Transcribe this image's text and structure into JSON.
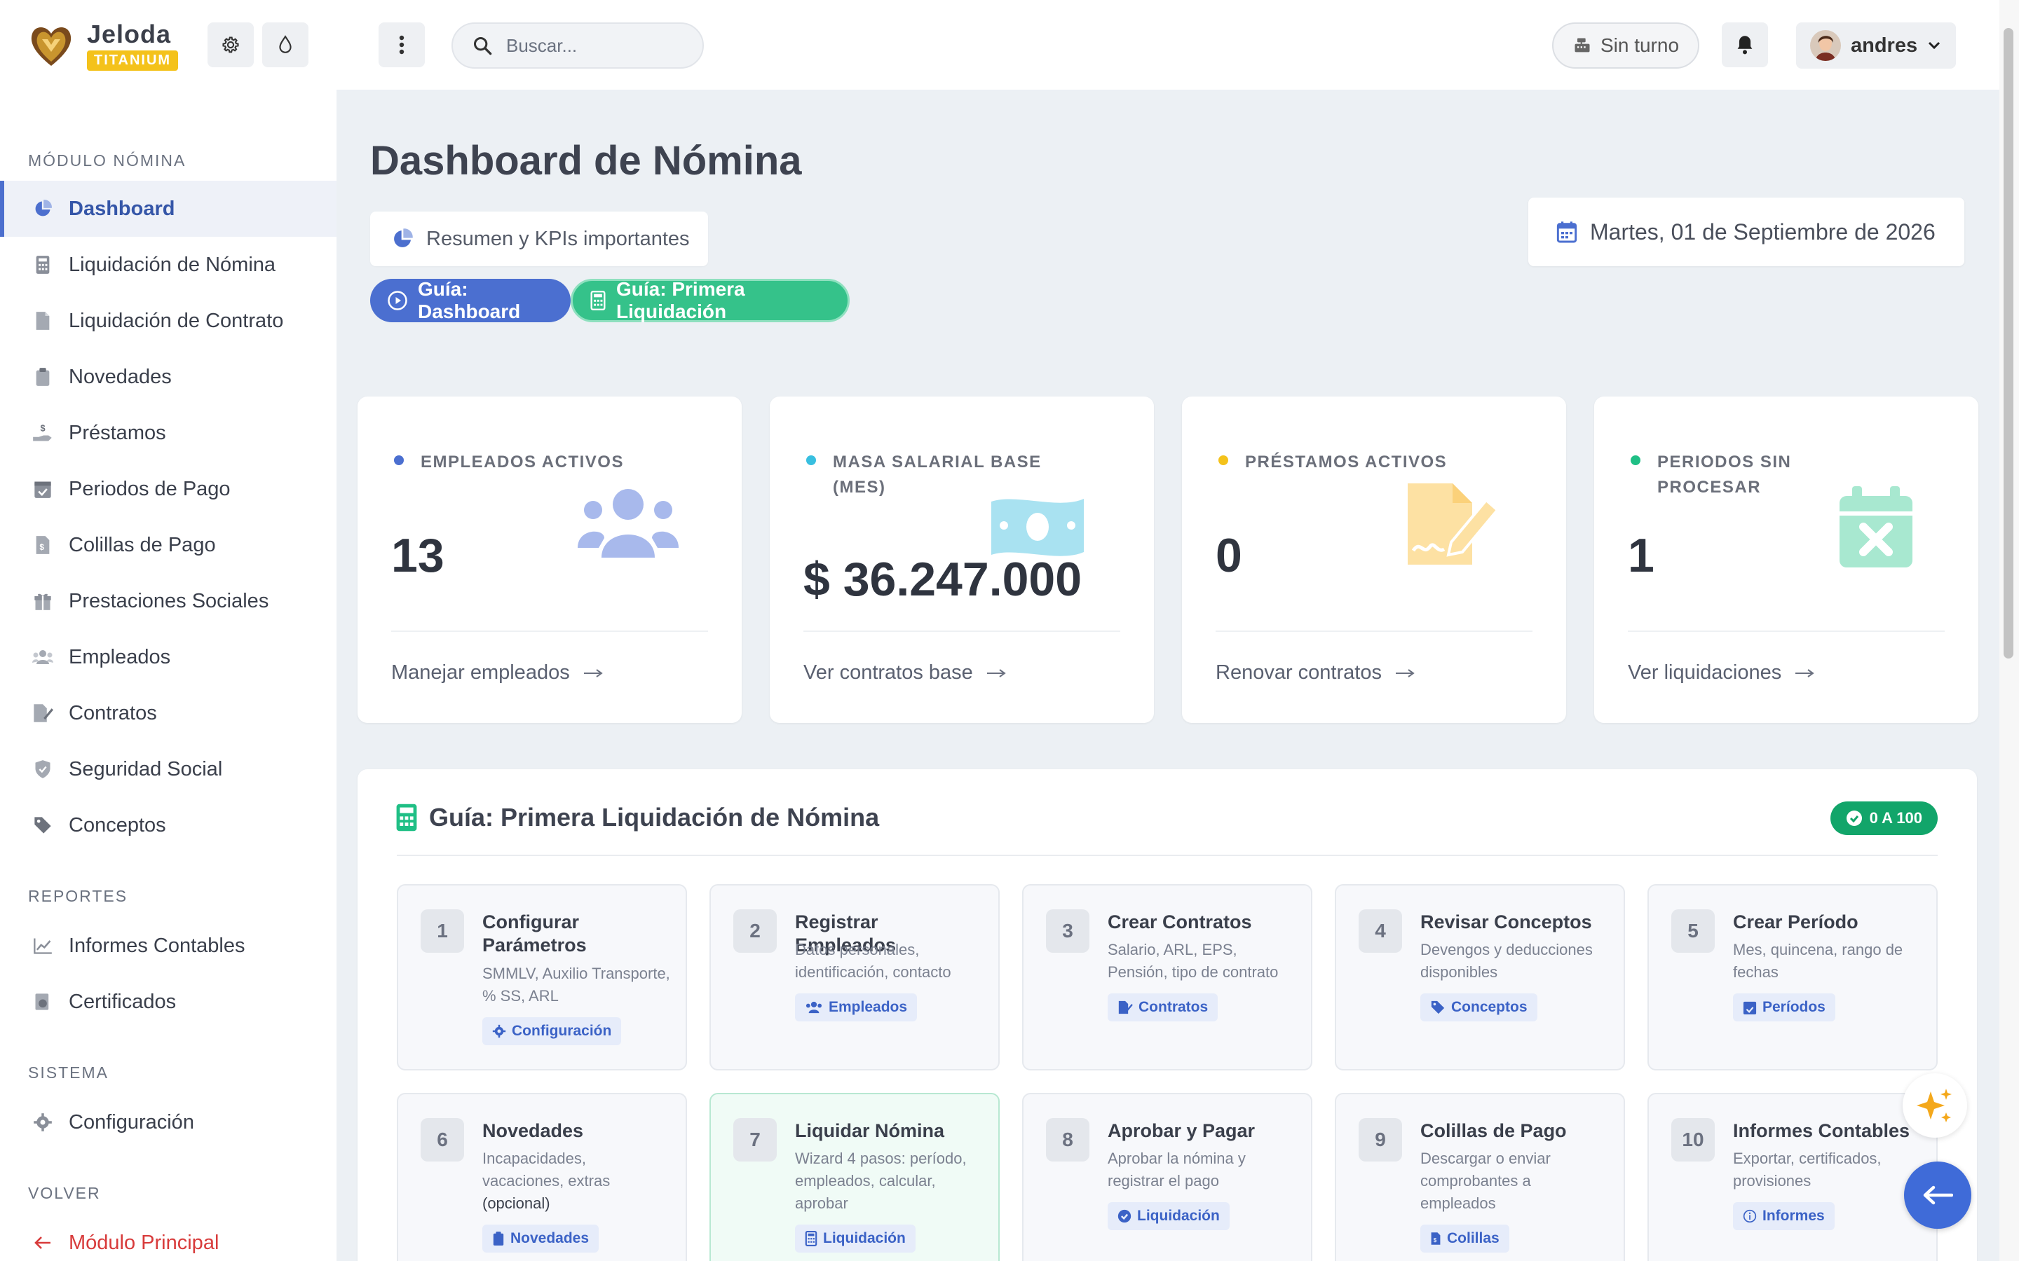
{
  "brand": {
    "name": "Jeloda",
    "edition": "TITANIUM"
  },
  "topbar": {
    "search_placeholder": "Buscar...",
    "shift_label": "Sin turno",
    "user_name": "andres"
  },
  "sidebar": {
    "sections": [
      {
        "title": "MÓDULO NÓMINA"
      },
      {
        "title": "REPORTES"
      },
      {
        "title": "SISTEMA"
      },
      {
        "title": "VOLVER"
      }
    ],
    "items": [
      {
        "label": "Dashboard",
        "icon": "pie-chart-icon",
        "active": true
      },
      {
        "label": "Liquidación de Nómina",
        "icon": "calculator-icon"
      },
      {
        "label": "Liquidación de Contrato",
        "icon": "file-icon"
      },
      {
        "label": "Novedades",
        "icon": "clipboard-icon"
      },
      {
        "label": "Préstamos",
        "icon": "hand-money-icon"
      },
      {
        "label": "Periodos de Pago",
        "icon": "calendar-check-icon"
      },
      {
        "label": "Colillas de Pago",
        "icon": "invoice-icon"
      },
      {
        "label": "Prestaciones Sociales",
        "icon": "gift-icon"
      },
      {
        "label": "Empleados",
        "icon": "users-icon"
      },
      {
        "label": "Contratos",
        "icon": "file-signature-icon"
      },
      {
        "label": "Seguridad Social",
        "icon": "shield-icon"
      },
      {
        "label": "Conceptos",
        "icon": "tags-icon"
      },
      {
        "label": "Informes Contables",
        "icon": "chart-line-icon"
      },
      {
        "label": "Certificados",
        "icon": "certificate-icon"
      },
      {
        "label": "Configuración",
        "icon": "gear-icon"
      },
      {
        "label": "Módulo Principal",
        "icon": "arrow-left-icon"
      }
    ]
  },
  "main": {
    "title": "Dashboard de Nómina",
    "subtitle": "Resumen y KPIs importantes",
    "guide_buttons": [
      "Guía: Dashboard",
      "Guía: Primera Liquidación"
    ],
    "date": "Martes, 01 de Septiembre de 2026"
  },
  "kpis": [
    {
      "label": "EMPLEADOS ACTIVOS",
      "value": "13",
      "link": "Manejar empleados",
      "color": "#4b6fd0",
      "icon": "users-icon"
    },
    {
      "label": "MASA SALARIAL BASE (MES)",
      "value": "$ 36.247.000",
      "link": "Ver contratos base",
      "color": "#38bfe0",
      "icon": "money-bill-icon"
    },
    {
      "label": "PRÉSTAMOS ACTIVOS",
      "value": "0",
      "link": "Renovar contratos",
      "color": "#f4c21b",
      "icon": "file-signature-icon"
    },
    {
      "label": "PERIODOS SIN PROCESAR",
      "value": "1",
      "link": "Ver liquidaciones",
      "color": "#1fbf85",
      "icon": "calendar-x-icon"
    }
  ],
  "guide": {
    "title": "Guía: Primera Liquidación de Nómina",
    "badge": "0 A 100",
    "steps": [
      {
        "num": "1",
        "title": "Configurar Parámetros",
        "desc": "SMMLV, Auxilio Transporte, % SS, ARL",
        "tag": "Configuración"
      },
      {
        "num": "2",
        "title": "Registrar Empleados",
        "desc": "Datos personales, identificación, contacto",
        "tag": "Empleados"
      },
      {
        "num": "3",
        "title": "Crear Contratos",
        "desc": "Salario, ARL, EPS, Pensión, tipo de contrato",
        "tag": "Contratos"
      },
      {
        "num": "4",
        "title": "Revisar Conceptos",
        "desc": "Devengos y deducciones disponibles",
        "tag": "Conceptos"
      },
      {
        "num": "5",
        "title": "Crear Período",
        "desc": "Mes, quincena, rango de fechas",
        "tag": "Períodos"
      },
      {
        "num": "6",
        "title": "Novedades",
        "desc": "Incapacidades, vacaciones, extras",
        "desc2": "(opcional)",
        "tag": "Novedades"
      },
      {
        "num": "7",
        "title": "Liquidar Nómina",
        "desc": "Wizard 4 pasos: período, empleados, calcular, aprobar",
        "tag": "Liquidación"
      },
      {
        "num": "8",
        "title": "Aprobar y Pagar",
        "desc": "Aprobar la nómina y registrar el pago",
        "tag": "Liquidación"
      },
      {
        "num": "9",
        "title": "Colillas de Pago",
        "desc": "Descargar o enviar comprobantes a empleados",
        "tag": "Colillas"
      },
      {
        "num": "10",
        "title": "Informes Contables",
        "desc": "Exportar, certificados, provisiones",
        "tag": "Informes"
      }
    ]
  }
}
